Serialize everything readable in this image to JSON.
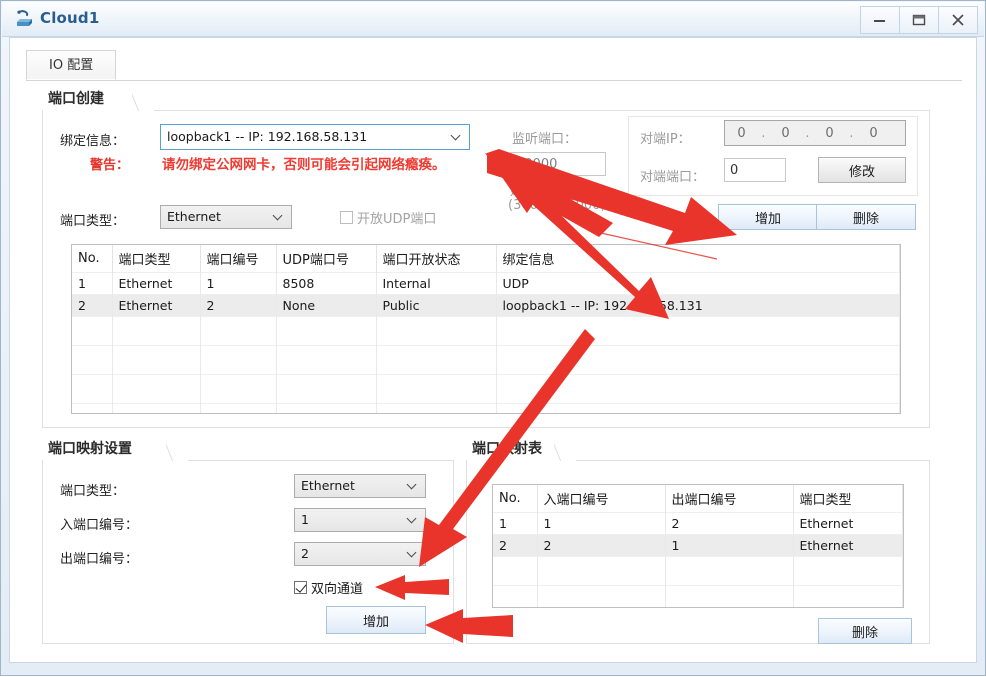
{
  "window": {
    "title": "Cloud1",
    "icon": "cloud-icon",
    "buttons": {
      "minimize": "—",
      "maximize": "❐",
      "close": "X"
    }
  },
  "tabs": [
    {
      "label": "IO 配置",
      "selected": true
    }
  ],
  "port_create": {
    "group_title": "端口创建",
    "bind_label": "绑定信息：",
    "bind_value": "loopback1 -- IP: 192.168.58.131",
    "warn_label": "警告：",
    "warn_text": "请勿绑定公网网卡，否则可能会引起网络瘾痪。",
    "port_type_label": "端口类型：",
    "port_type_value": "Ethernet",
    "udp_checkbox_label": "开放UDP端口",
    "udp_checked": false,
    "listen_port_label": "监听端口：",
    "listen_port_value": "30000",
    "listen_hint_line1": "建议",
    "listen_hint_line2": "(30000-35000)",
    "peer_ip_label": "对端IP：",
    "peer_ip_octets": [
      "0",
      "0",
      "0",
      "0"
    ],
    "peer_port_label": "对端端口：",
    "peer_port_value": "0",
    "modify_button": "修改",
    "add_button": "增加",
    "delete_button": "删除"
  },
  "port_table": {
    "headers": [
      "No.",
      "端口类型",
      "端口编号",
      "UDP端口号",
      "端口开放状态",
      "绑定信息"
    ],
    "rows": [
      {
        "cells": [
          "1",
          "Ethernet",
          "1",
          "8508",
          "Internal",
          "UDP"
        ],
        "selected": false
      },
      {
        "cells": [
          "2",
          "Ethernet",
          "2",
          "None",
          "Public",
          "loopback1 -- IP: 192.168.58.131"
        ],
        "selected": true
      }
    ],
    "empty_rows": 4
  },
  "mapping_settings": {
    "group_title": "端口映射设置",
    "port_type_label": "端口类型：",
    "port_type_value": "Ethernet",
    "in_port_label": "入端口编号：",
    "in_port_value": "1",
    "out_port_label": "出端口编号：",
    "out_port_value": "2",
    "bidirectional_label": "双向通道",
    "bidirectional_checked": true,
    "add_button": "增加"
  },
  "mapping_table": {
    "group_title": "端口映射表",
    "headers": [
      "No.",
      "入端口编号",
      "出端口编号",
      "端口类型"
    ],
    "rows": [
      {
        "cells": [
          "1",
          "1",
          "2",
          "Ethernet"
        ],
        "selected": false
      },
      {
        "cells": [
          "2",
          "2",
          "1",
          "Ethernet"
        ],
        "selected": true
      }
    ],
    "empty_rows": 3,
    "delete_button": "删除"
  },
  "annotation": {
    "color": "#e8342b",
    "arrow_count": 5
  }
}
